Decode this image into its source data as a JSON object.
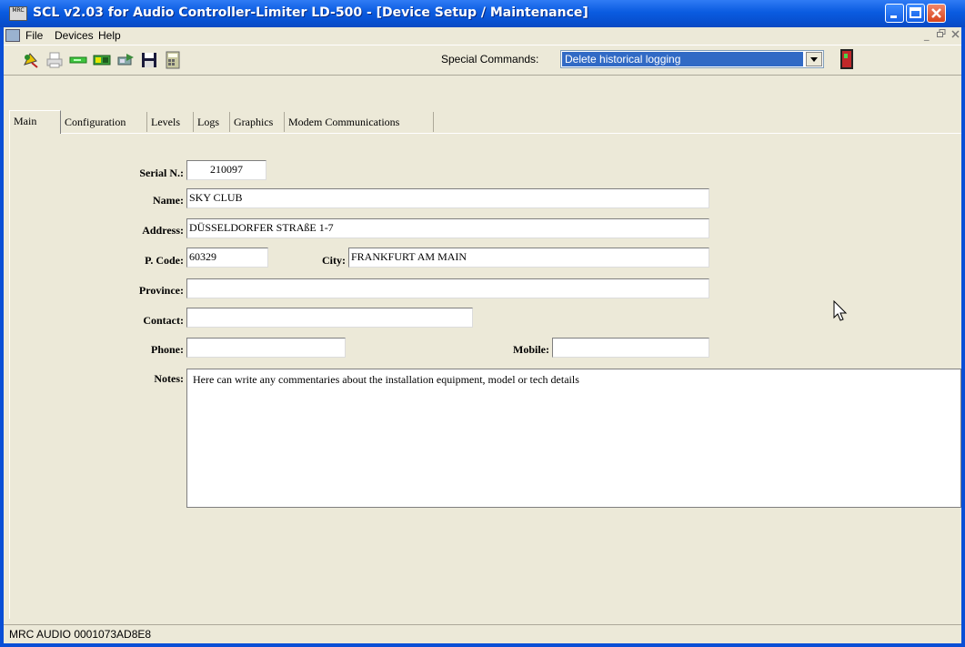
{
  "window": {
    "title": "SCL v2.03 for Audio Controller-Limiter LD-500 - [Device Setup / Maintenance]",
    "app_icon_text": "MRC"
  },
  "menu": {
    "items": [
      "File",
      "Devices",
      "Help"
    ],
    "mdi_controls": [
      "_",
      "̅❐",
      "✕"
    ]
  },
  "toolbar": {
    "tools": [
      "connect-icon",
      "print-icon",
      "green-device-icon",
      "device-icon",
      "tools-icon",
      "save-icon",
      "calculator-icon"
    ],
    "special_commands_label": "Special Commands:",
    "special_commands_value": "Delete historical logging"
  },
  "tabs": [
    "Main",
    "Configuration",
    "Levels",
    "Logs",
    "Graphics",
    "Modem Communications"
  ],
  "form": {
    "serial_label": "Serial N.:",
    "serial_value": "210097",
    "name_label": "Name:",
    "name_value": "SKY CLUB",
    "address_label": "Address:",
    "address_value": "DÜSSELDORFER STRAßE 1-7",
    "pcode_label": "P. Code:",
    "pcode_value": "60329",
    "city_label": "City:",
    "city_value": "FRANKFURT AM MAIN",
    "province_label": "Province:",
    "province_value": "",
    "contact_label": "Contact:",
    "contact_value": "",
    "phone_label": "Phone:",
    "phone_value": "",
    "mobile_label": "Mobile:",
    "mobile_value": "",
    "notes_label": "Notes:",
    "notes_value": "Here can write any commentaries about the installation equipment, model or tech details"
  },
  "status": {
    "text": "MRC AUDIO 0001073AD8E8"
  }
}
